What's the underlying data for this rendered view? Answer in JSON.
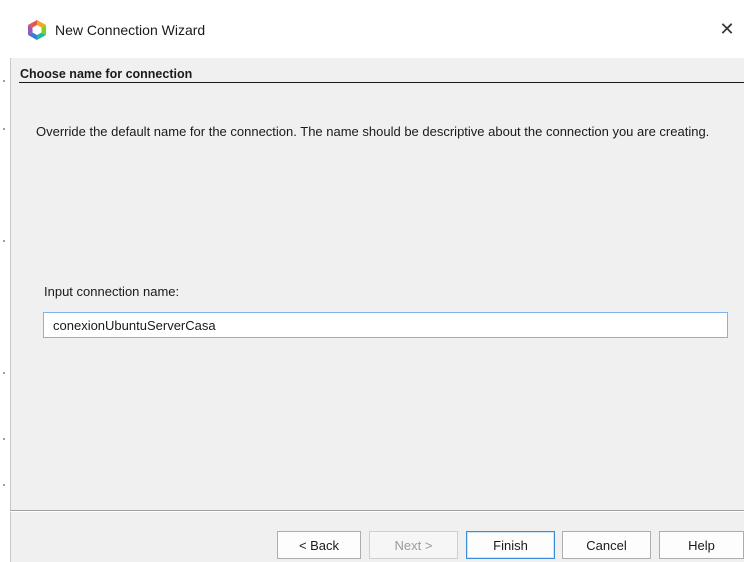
{
  "window": {
    "title": "New Connection Wizard",
    "icon": "hexagon-app-icon",
    "close_glyph": "✕"
  },
  "page": {
    "section_title": "Choose name for connection",
    "description": "Override the default name for the connection. The name should be descriptive about the connection you are creating.",
    "input_label": "Input connection name:",
    "input_value": "conexionUbuntuServerCasa"
  },
  "buttons": {
    "back": "< Back",
    "next": "Next >",
    "finish": "Finish",
    "cancel": "Cancel",
    "help": "Help"
  },
  "colors": {
    "accent": "#3c8bd9",
    "input_border": "#7eb4ea"
  }
}
